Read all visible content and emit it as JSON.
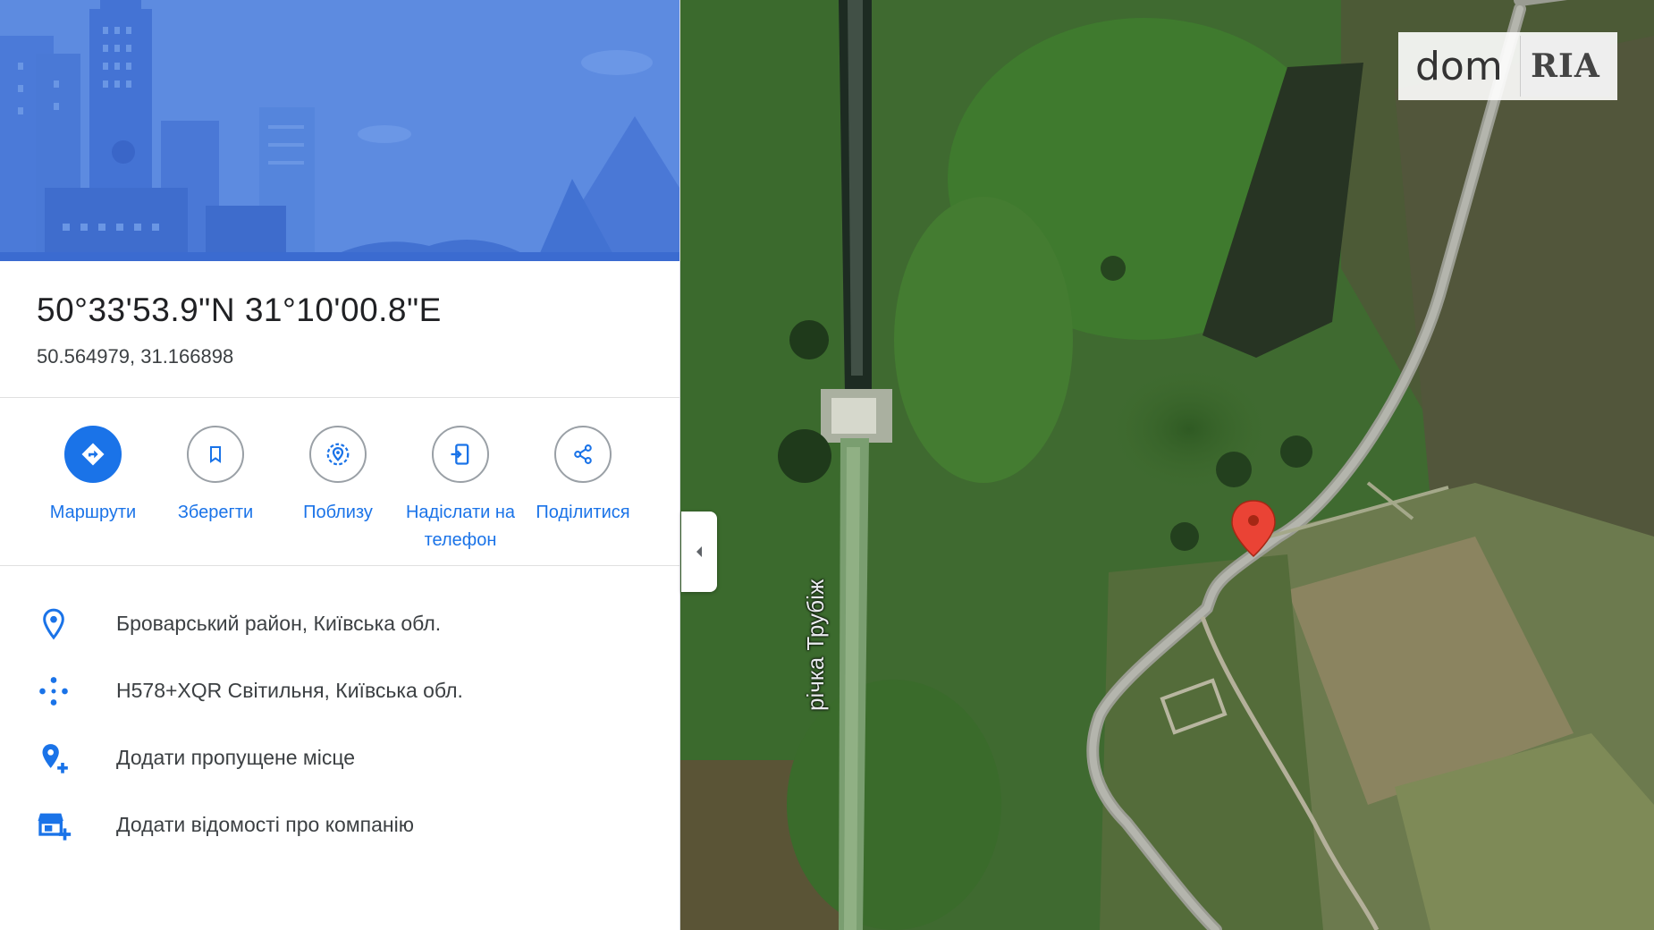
{
  "place": {
    "coordinates_dms": "50°33'53.9\"N 31°10'00.8\"E",
    "coordinates_decimal": "50.564979, 31.166898"
  },
  "actions": [
    {
      "label": "Маршрути",
      "icon": "directions-icon"
    },
    {
      "label": "Зберегти",
      "icon": "bookmark-icon"
    },
    {
      "label": "Поблизу",
      "icon": "nearby-icon"
    },
    {
      "label": "Надіслати на телефон",
      "icon": "send-to-phone-icon"
    },
    {
      "label": "Поділитися",
      "icon": "share-icon"
    }
  ],
  "info": [
    {
      "text": "Броварський район, Київська обл.",
      "icon": "location-pin-icon"
    },
    {
      "text": "H578+XQR Світильня, Київська обл.",
      "icon": "plus-code-icon"
    },
    {
      "text": "Додати пропущене місце",
      "icon": "add-place-icon"
    },
    {
      "text": "Додати відомості про компанію",
      "icon": "add-business-icon"
    }
  ],
  "map": {
    "river_label": "річка Трубіж",
    "view": "satellite",
    "marker_color": "#ea4335"
  },
  "watermark": {
    "dom": "dom",
    "ria": "RIA"
  },
  "colors": {
    "accent": "#1a73e8",
    "hero": "#5b8ae0"
  }
}
